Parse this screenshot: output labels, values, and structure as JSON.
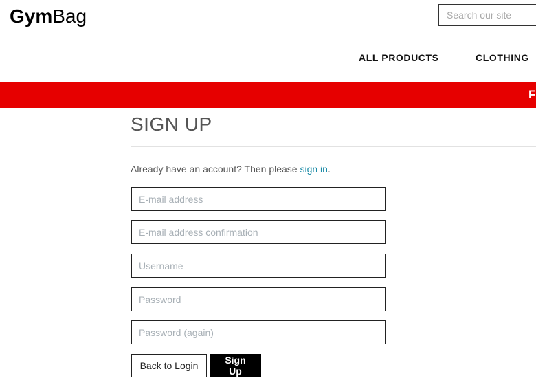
{
  "header": {
    "logo_bold": "Gym",
    "logo_light": "Bag",
    "search_placeholder": "Search our site"
  },
  "nav": {
    "items": [
      {
        "label": "ALL PRODUCTS"
      },
      {
        "label": "CLOTHING"
      }
    ]
  },
  "banner": {
    "text": "F",
    "color": "#e60000"
  },
  "main": {
    "title": "SIGN UP",
    "prompt_text": "Already have an account? Then please ",
    "prompt_link": "sign in",
    "prompt_end": ".",
    "fields": [
      {
        "placeholder": "E-mail address",
        "value": ""
      },
      {
        "placeholder": "E-mail address confirmation",
        "value": ""
      },
      {
        "placeholder": "Username",
        "value": ""
      },
      {
        "placeholder": "Password",
        "value": ""
      },
      {
        "placeholder": "Password (again)",
        "value": ""
      }
    ],
    "buttons": {
      "back_label": "Back to Login",
      "signup_label": "Sign Up"
    }
  }
}
